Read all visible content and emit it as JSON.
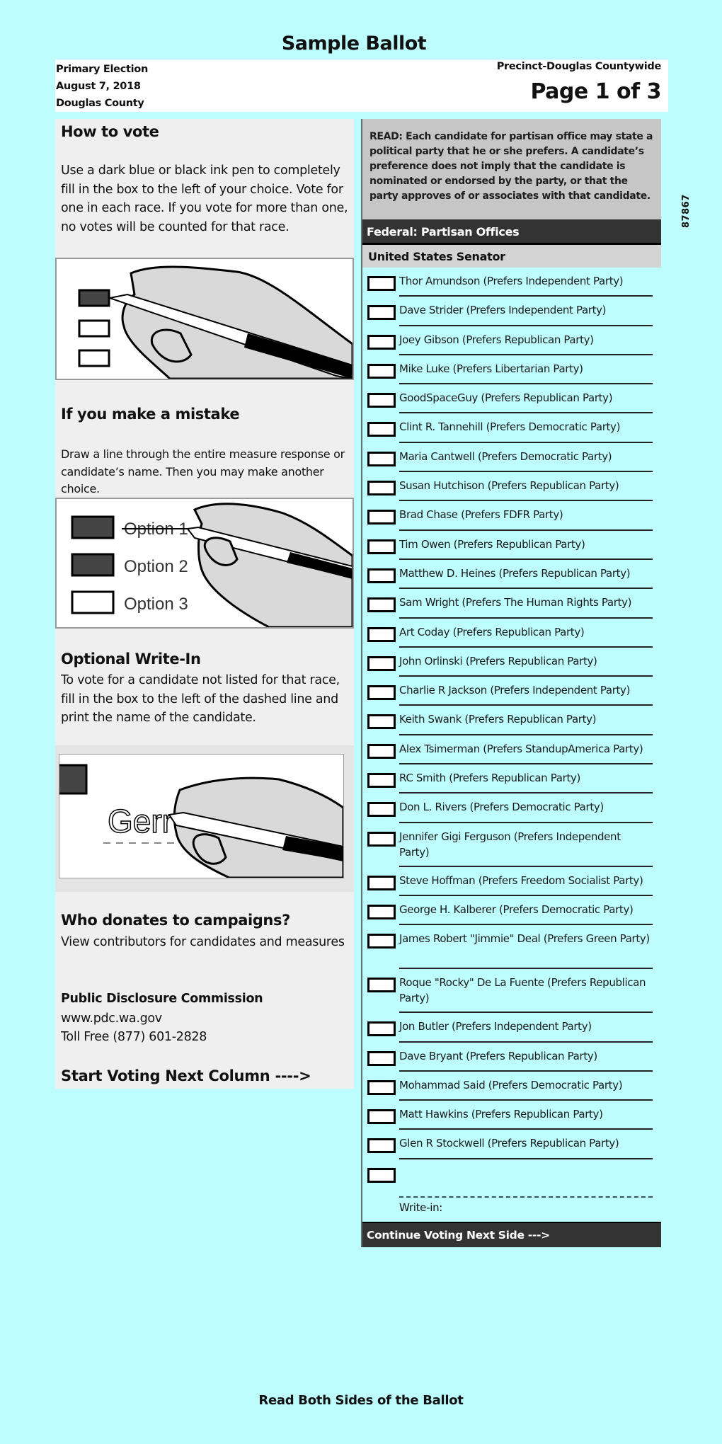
{
  "title": "Sample Ballot",
  "header": {
    "election": "Primary Election",
    "date": "August 7, 2018",
    "county": "Douglas County",
    "precinct": "Precinct-Douglas Countywide",
    "page": "Page 1 of 3"
  },
  "side_number": "87867",
  "instructions": {
    "how_to_vote": {
      "heading": "How to vote",
      "text": "Use a dark blue or black ink pen to completely fill in the box to the left of your choice.  Vote for one in each race.  If you vote for more than one, no votes will be counted for that race."
    },
    "mistake": {
      "heading": "If you make a mistake",
      "text": "Draw a line through the entire measure response or candidate’s name.  Then you may make another choice.",
      "illustration_options": [
        "Option 1",
        "Option 2",
        "Option 3"
      ]
    },
    "write_in": {
      "heading": "Optional Write-In",
      "text": "To vote for a candidate not listed for that race, fill in the box to the left of the dashed line and print the name of the candidate.",
      "illustration_text": "Gerr"
    },
    "donations": {
      "heading": "Who donates to campaigns?",
      "text": "View contributors for candidates and measures",
      "org": "Public Disclosure Commission",
      "url": "www.pdc.wa.gov",
      "phone": "Toll Free (877) 601-2828"
    },
    "start_next": "Start Voting Next Column ---->"
  },
  "ballot": {
    "read_notice": "READ: Each candidate for partisan office may state a political party that he or she prefers. A candidate’s preference does not imply that the candidate is nominated or endorsed by the party, or that the party approves of or associates with that candidate.",
    "section": "Federal: Partisan Offices",
    "race": "United States Senator",
    "candidates": [
      "Thor Amundson (Prefers Independent Party)",
      "Dave Strider (Prefers Independent Party)",
      "Joey Gibson  (Prefers Republican Party)",
      "Mike Luke (Prefers Libertarian Party)",
      "GoodSpaceGuy (Prefers Republican Party)",
      "Clint R. Tannehill (Prefers Democratic Party)",
      "Maria Cantwell (Prefers Democratic Party)",
      "Susan Hutchison (Prefers Republican Party)",
      "Brad Chase (Prefers FDFR Party)",
      "Tim Owen (Prefers Republican Party)",
      "Matthew D. Heines (Prefers Republican Party)",
      "Sam Wright (Prefers The Human Rights Party)",
      "Art Coday (Prefers Republican Party)",
      "John Orlinski (Prefers Republican Party)",
      "Charlie R Jackson (Prefers Independent Party)",
      "Keith Swank (Prefers Republican Party)",
      "Alex Tsimerman (Prefers StandupAmerica Party)",
      "RC Smith (Prefers Republican Party)",
      "Don L. Rivers (Prefers Democratic Party)",
      "Jennifer Gigi Ferguson (Prefers Independent Party)",
      "Steve Hoffman (Prefers Freedom Socialist Party)",
      "George H. Kalberer (Prefers Democratic Party)",
      "James Robert \"Jimmie\" Deal (Prefers Green Party)",
      "Roque \"Rocky\" De La Fuente (Prefers Republican Party)",
      "Jon Butler (Prefers Independent Party)",
      "Dave Bryant (Prefers Republican Party)",
      "Mohammad Said (Prefers Democratic Party)",
      "Matt Hawkins (Prefers Republican Party)",
      "Glen R Stockwell (Prefers Republican Party)"
    ],
    "write_in_label": "Write-in:",
    "continue": "Continue Voting Next Side --->"
  },
  "footer": "Read Both Sides of the Ballot"
}
